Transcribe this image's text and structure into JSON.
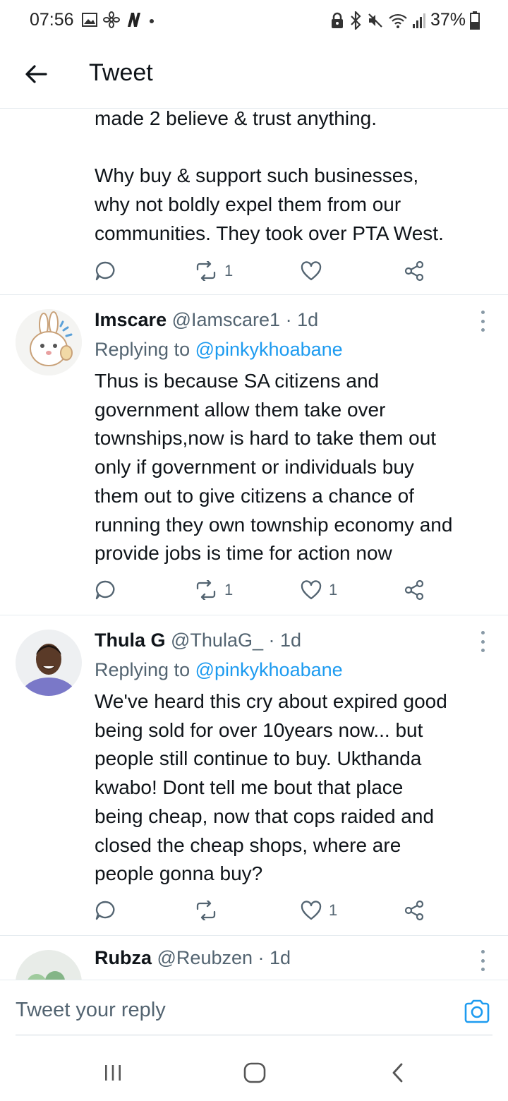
{
  "status_bar": {
    "time": "07:56",
    "battery": "37%",
    "icons": [
      "image-icon",
      "fan-icon",
      "n-app-icon",
      "dot-icon",
      "lock-icon",
      "bluetooth-icon",
      "mute-icon",
      "wifi-icon",
      "signal-icon",
      "battery-icon"
    ]
  },
  "header": {
    "title": "Tweet",
    "back_icon": "arrow-left-icon"
  },
  "continued_tweet": {
    "text": "made 2 believe & trust anything.\n\nWhy buy & support such businesses,\nwhy not boldly expel them from our\ncommunities. They took over PTA West.",
    "retweets": "1",
    "likes": ""
  },
  "tweets": [
    {
      "name": "Imscare",
      "handle": "@Iamscare1",
      "time": "· 1d",
      "replying_label": "Replying to ",
      "replying_to": "@pinkykhoabane",
      "text": "Thus is because SA citizens and\ngovernment allow them take over\ntownships,now is hard to take them out\nonly if government or individuals buy\nthem out to give citizens a chance of\nrunning they own township economy and\nprovide jobs is time for action now",
      "retweets": "1",
      "likes": "1"
    },
    {
      "name": "Thula G",
      "handle": "@ThulaG_",
      "time": "· 1d",
      "replying_label": "Replying to ",
      "replying_to": "@pinkykhoabane",
      "text": "We've heard this cry about expired good\nbeing sold for over 10years now... but\npeople still continue to buy. Ukthanda\nkwabo! Dont tell me bout that place\nbeing cheap, now that cops raided and\nclosed the cheap shops, where are\npeople gonna buy?",
      "retweets": "",
      "likes": "1"
    },
    {
      "name": "Rubza",
      "handle": "@Reubzen",
      "time": "· 1d"
    }
  ],
  "reply_bar": {
    "placeholder": "Tweet your reply",
    "camera_icon": "camera-icon"
  },
  "nav_bar": {
    "icons": [
      "recent-apps-icon",
      "home-icon",
      "back-icon"
    ]
  },
  "colors": {
    "accent": "#1d9bf0",
    "text": "#0f1419",
    "secondary": "#536471",
    "divider": "#e6ecf0"
  }
}
